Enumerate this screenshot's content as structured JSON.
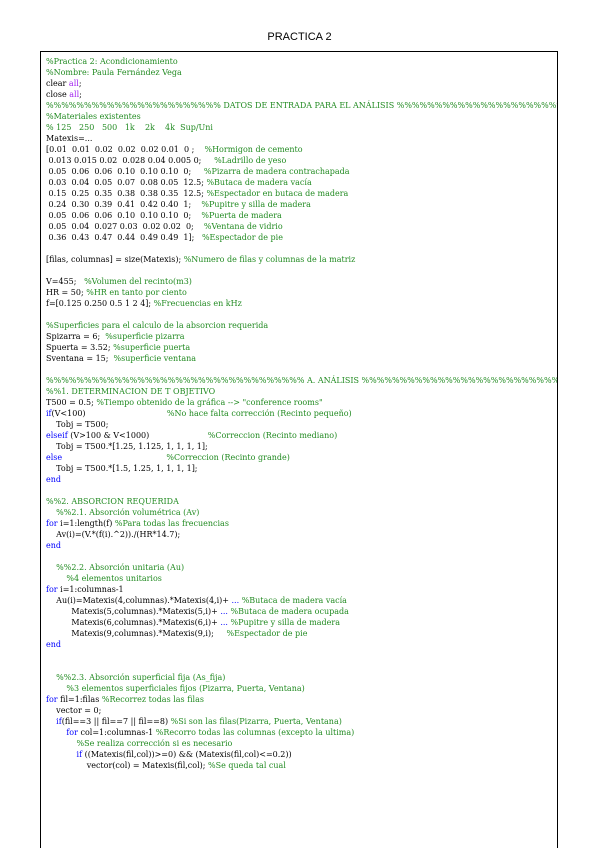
{
  "page": {
    "title": "PRACTICA 2"
  },
  "lines": [
    [
      [
        "c",
        "%Practica 2: Acondicionamiento"
      ]
    ],
    [
      [
        "c",
        "%Nombre: Paula Fernández Vega"
      ]
    ],
    [
      [
        "t",
        "clear "
      ],
      [
        "s",
        "all"
      ],
      [
        "t",
        ";"
      ]
    ],
    [
      [
        "t",
        "close "
      ],
      [
        "s",
        "all"
      ],
      [
        "t",
        ";"
      ]
    ],
    [
      [
        "c",
        "%%%%%%%%%%%%%%%%%%%%%%% DATOS DE ENTRADA PARA EL ANÁLISIS %%%%%%%%%%%%%%%%%%%%%%%%"
      ]
    ],
    [
      [
        "c",
        "%Materiales existentes"
      ]
    ],
    [
      [
        "c",
        "% 125   250   500   1k    2k    4k  Sup/Uni"
      ]
    ],
    [
      [
        "t",
        "Matexis=..."
      ]
    ],
    [
      [
        "t",
        "[0.01  0.01  0.02  0.02  0.02 0.01  0 ;    "
      ],
      [
        "c",
        "%Hormigon de cemento"
      ]
    ],
    [
      [
        "t",
        " 0.013 0.015 0.02  0.028 0.04 0.005 0;     "
      ],
      [
        "c",
        "%Ladrillo de yeso"
      ]
    ],
    [
      [
        "t",
        " 0.05  0.06  0.06  0.10  0.10 0.10  0;     "
      ],
      [
        "c",
        "%Pizarra de madera contrachapada"
      ]
    ],
    [
      [
        "t",
        " 0.03  0.04  0.05  0.07  0.08 0.05  12.5; "
      ],
      [
        "c",
        "%Butaca de madera vacía"
      ]
    ],
    [
      [
        "t",
        " 0.15  0.25  0.35  0.38  0.38 0.35  12.5; "
      ],
      [
        "c",
        "%Espectador en butaca de madera"
      ]
    ],
    [
      [
        "t",
        " 0.24  0.30  0.39  0.41  0.42 0.40  1;    "
      ],
      [
        "c",
        "%Pupitre y silla de madera"
      ]
    ],
    [
      [
        "t",
        " 0.05  0.06  0.06  0.10  0.10 0.10  0;    "
      ],
      [
        "c",
        "%Puerta de madera"
      ]
    ],
    [
      [
        "t",
        " 0.05  0.04  0.027 0.03  0.02 0.02  0;    "
      ],
      [
        "c",
        "%Ventana de vidrio"
      ]
    ],
    [
      [
        "t",
        " 0.36  0.43  0.47  0.44  0.49 0.49  1];   "
      ],
      [
        "c",
        "%Espectador de pie"
      ]
    ],
    [],
    [
      [
        "t",
        "[filas, columnas] = size(Matexis); "
      ],
      [
        "c",
        "%Numero de filas y columnas de la matriz"
      ]
    ],
    [],
    [
      [
        "t",
        "V=455;   "
      ],
      [
        "c",
        "%Volumen del recinto(m3)"
      ]
    ],
    [
      [
        "t",
        "HR = 50; "
      ],
      [
        "c",
        "%HR en tanto por ciento"
      ]
    ],
    [
      [
        "t",
        "f=[0.125 0.250 0.5 1 2 4]; "
      ],
      [
        "c",
        "%Frecuencias en kHz"
      ]
    ],
    [],
    [
      [
        "c",
        "%Superficies para el calculo de la absorcion requerida"
      ]
    ],
    [
      [
        "t",
        "Spizarra = 6;  "
      ],
      [
        "c",
        "%superficie pizarra"
      ]
    ],
    [
      [
        "t",
        "Spuerta = 3.52; "
      ],
      [
        "c",
        "%superficie puerta"
      ]
    ],
    [
      [
        "t",
        "Sventana = 15;  "
      ],
      [
        "c",
        "%superficie ventana"
      ]
    ],
    [],
    [
      [
        "c",
        "%%%%%%%%%%%%%%%%%%%%%%%%%%%%%%%%%% A. ANÁLISIS %%%%%%%%%%%%%%%%%%%%%%%%%%%%%%%%%"
      ]
    ],
    [
      [
        "c",
        "%%1. DETERMINACION DE T OBJETIVO"
      ]
    ],
    [
      [
        "t",
        "T500 = 0.5; "
      ],
      [
        "c",
        "%Tiempo obtenido de la gráfica --> \"conference rooms\""
      ]
    ],
    [
      [
        "k",
        "if"
      ],
      [
        "t",
        "(V<100)                                "
      ],
      [
        "c",
        "%No hace falta corrección (Recinto pequeño)"
      ]
    ],
    [
      [
        "t",
        "    Tobj = T500;"
      ]
    ],
    [
      [
        "k",
        "elseif"
      ],
      [
        "t",
        " (V>100 & V<1000)                       "
      ],
      [
        "c",
        "%Correccion (Recinto mediano)"
      ]
    ],
    [
      [
        "t",
        "    Tobj = T500.*[1.25, 1.125, 1, 1, 1, 1];"
      ]
    ],
    [
      [
        "k",
        "else"
      ],
      [
        "t",
        "                                         "
      ],
      [
        "c",
        "%Correccion (Recinto grande)"
      ]
    ],
    [
      [
        "t",
        "    Tobj = T500.*[1.5, 1.25, 1, 1, 1, 1];"
      ]
    ],
    [
      [
        "k",
        "end"
      ]
    ],
    [],
    [
      [
        "c",
        "%%2. ABSORCION REQUERIDA"
      ]
    ],
    [
      [
        "t",
        "    "
      ],
      [
        "c",
        "%%2.1. Absorción volumétrica (Av)"
      ]
    ],
    [
      [
        "k",
        "for"
      ],
      [
        "t",
        " i=1:length(f) "
      ],
      [
        "c",
        "%Para todas las frecuencias"
      ]
    ],
    [
      [
        "t",
        "    Av(i)=(V.*(f(i).^2))./(HR*14.7);"
      ]
    ],
    [
      [
        "k",
        "end"
      ]
    ],
    [],
    [
      [
        "t",
        "    "
      ],
      [
        "c",
        "%%2.2. Absorción unitaria (Au)"
      ]
    ],
    [
      [
        "t",
        "        "
      ],
      [
        "c",
        "%4 elementos unitarios"
      ]
    ],
    [
      [
        "k",
        "for"
      ],
      [
        "t",
        " i=1:columnas-1"
      ]
    ],
    [
      [
        "t",
        "    Au(i)=Matexis(4,columnas).*Matexis(4,i)+ "
      ],
      [
        "k",
        "..."
      ],
      [
        "t",
        " "
      ],
      [
        "c",
        "%Butaca de madera vacía"
      ]
    ],
    [
      [
        "t",
        "          Matexis(5,columnas).*Matexis(5,i)+ "
      ],
      [
        "k",
        "..."
      ],
      [
        "t",
        " "
      ],
      [
        "c",
        "%Butaca de madera ocupada"
      ]
    ],
    [
      [
        "t",
        "          Matexis(6,columnas).*Matexis(6,i)+ "
      ],
      [
        "k",
        "..."
      ],
      [
        "t",
        " "
      ],
      [
        "c",
        "%Pupitre y silla de madera"
      ]
    ],
    [
      [
        "t",
        "          Matexis(9,columnas).*Matexis(9,i);     "
      ],
      [
        "c",
        "%Espectador de pie"
      ]
    ],
    [
      [
        "k",
        "end"
      ]
    ],
    [],
    [],
    [
      [
        "t",
        "    "
      ],
      [
        "c",
        "%%2.3. Absorción superficial fija (As_fija)"
      ]
    ],
    [
      [
        "t",
        "        "
      ],
      [
        "c",
        "%3 elementos superficiales fijos (Pizarra, Puerta, Ventana)"
      ]
    ],
    [
      [
        "k",
        "for"
      ],
      [
        "t",
        " fil=1:filas "
      ],
      [
        "c",
        "%Recorrez todas las filas"
      ]
    ],
    [
      [
        "t",
        "    vector = 0;"
      ]
    ],
    [
      [
        "t",
        "    "
      ],
      [
        "k",
        "if"
      ],
      [
        "t",
        "(fil==3 || fil==7 || fil==8) "
      ],
      [
        "c",
        "%Si son las filas(Pizarra, Puerta, Ventana)"
      ]
    ],
    [
      [
        "t",
        "        "
      ],
      [
        "k",
        "for"
      ],
      [
        "t",
        " col=1:columnas-1 "
      ],
      [
        "c",
        "%Recorro todas las columnas (excepto la ultima)"
      ]
    ],
    [
      [
        "t",
        "            "
      ],
      [
        "c",
        "%Se realiza corrección si es necesario"
      ]
    ],
    [
      [
        "t",
        "            "
      ],
      [
        "k",
        "if"
      ],
      [
        "t",
        " ((Matexis(fil,col))>=0) && (Matexis(fil,col)<=0.2))"
      ]
    ],
    [
      [
        "t",
        "                vector(col) = Matexis(fil,col); "
      ],
      [
        "c",
        "%Se queda tal cual"
      ]
    ]
  ]
}
